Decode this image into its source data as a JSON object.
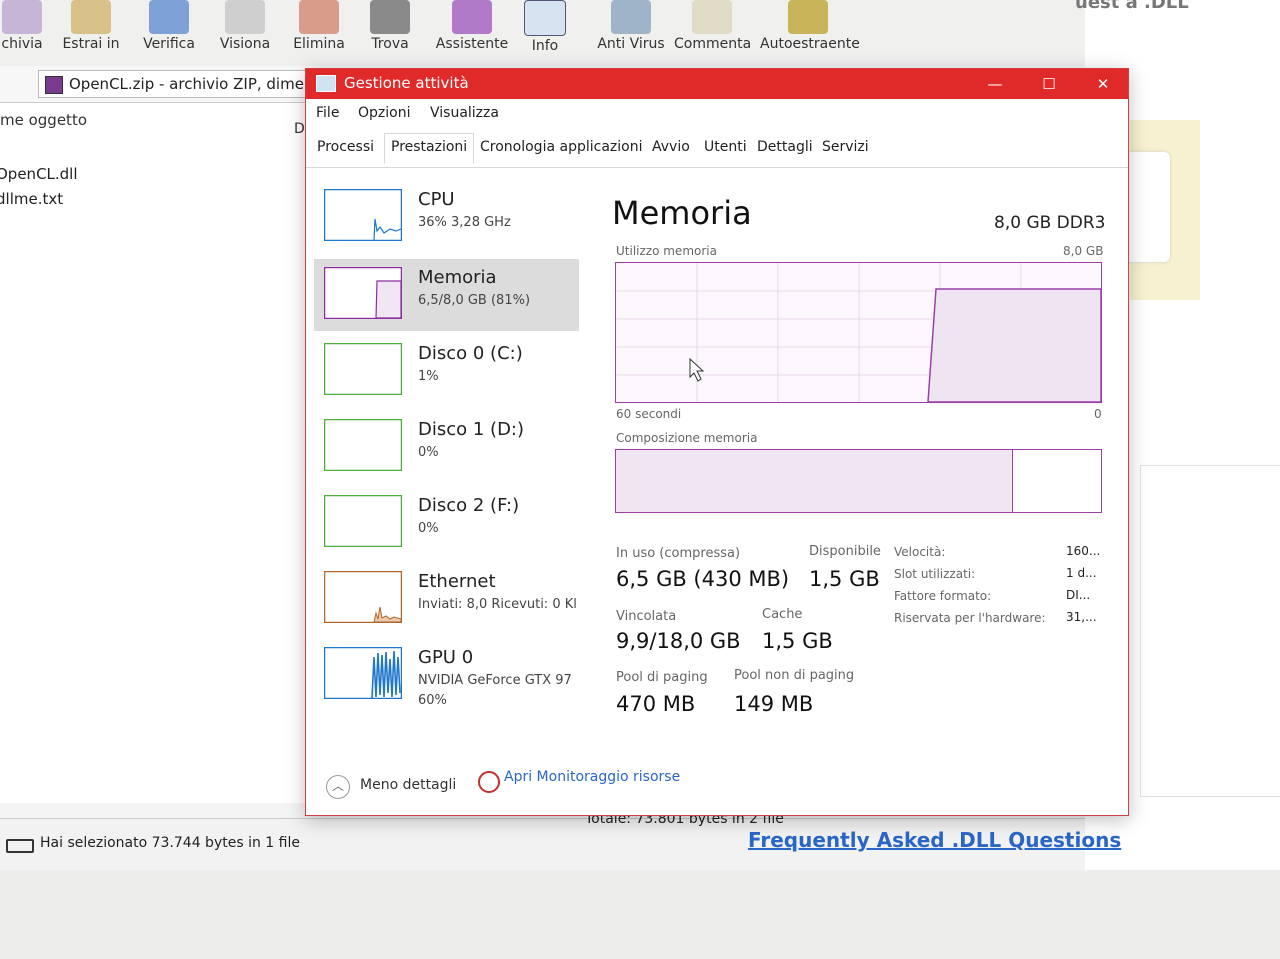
{
  "winrar": {
    "toolbar": [
      {
        "label": "chivia",
        "icon": "archive-icon"
      },
      {
        "label": "Estrai in",
        "icon": "extract-icon"
      },
      {
        "label": "Verifica",
        "icon": "test-icon"
      },
      {
        "label": "Visiona",
        "icon": "view-icon"
      },
      {
        "label": "Elimina",
        "icon": "delete-icon"
      },
      {
        "label": "Trova",
        "icon": "find-icon"
      },
      {
        "label": "Assistente",
        "icon": "wizard-icon"
      },
      {
        "label": "Info",
        "icon": "info-icon"
      },
      {
        "label": "Anti Virus",
        "icon": "antivirus-icon"
      },
      {
        "label": "Commenta",
        "icon": "comment-icon"
      },
      {
        "label": "Autoestraente",
        "icon": "sfx-icon"
      }
    ],
    "address": "OpenCL.zip - archivio ZIP, dime",
    "column_name": "me oggetto",
    "column_d": "D",
    "files": [
      "OpenCL.dll",
      "dllme.txt"
    ],
    "status_selected": "Hai selezionato 73.744 bytes in 1 file",
    "status_total": "Totale: 73.801 bytes in 2 file"
  },
  "web": {
    "heading_partial": "uest a .DLL",
    "link": "Frequently Asked .DLL Questions"
  },
  "taskmanager": {
    "title": "Gestione attività",
    "controls": {
      "minimize": "—",
      "maximize": "☐",
      "close": "✕"
    },
    "menu": [
      "File",
      "Opzioni",
      "Visualizza"
    ],
    "tabs": [
      "Processi",
      "Prestazioni",
      "Cronologia applicazioni",
      "Avvio",
      "Utenti",
      "Dettagli",
      "Servizi"
    ],
    "active_tab": "Prestazioni",
    "sidebar": [
      {
        "name": "CPU",
        "sub": "36% 3,28 GHz",
        "sub2": "",
        "color": "#1f77c9"
      },
      {
        "name": "Memoria",
        "sub": "6,5/8,0 GB (81%)",
        "sub2": "",
        "color": "#8b2fa0"
      },
      {
        "name": "Disco 0 (C:)",
        "sub": "1%",
        "sub2": "",
        "color": "#4caf3c"
      },
      {
        "name": "Disco 1 (D:)",
        "sub": "0%",
        "sub2": "",
        "color": "#4caf3c"
      },
      {
        "name": "Disco 2 (F:)",
        "sub": "0%",
        "sub2": "",
        "color": "#4caf3c"
      },
      {
        "name": "Ethernet",
        "sub": "Inviati: 8,0 Ricevuti: 0 Kl",
        "sub2": "",
        "color": "#b3662a"
      },
      {
        "name": "GPU 0",
        "sub": "NVIDIA GeForce GTX 97",
        "sub2": "60%",
        "color": "#1f77c9"
      }
    ],
    "memory": {
      "title": "Memoria",
      "spec": "8,0 GB DDR3",
      "usage_label": "Utilizzo memoria",
      "usage_max": "8,0 GB",
      "axis_left": "60 secondi",
      "axis_right": "0",
      "composition_label": "Composizione memoria",
      "in_use_label": "In uso (compressa)",
      "in_use_value": "6,5 GB (430 MB)",
      "available_label": "Disponibile",
      "available_value": "1,5 GB",
      "committed_label": "Vincolata",
      "committed_value": "9,9/18,0 GB",
      "cached_label": "Cache",
      "cached_value": "1,5 GB",
      "paged_label": "Pool di paging",
      "paged_value": "470 MB",
      "nonpaged_label": "Pool non di paging",
      "nonpaged_value": "149 MB",
      "details": [
        {
          "label": "Velocità:",
          "value": "160..."
        },
        {
          "label": "Slot utilizzati:",
          "value": "1 d..."
        },
        {
          "label": "Fattore formato:",
          "value": "DI..."
        },
        {
          "label": "Riservata per l'hardware:",
          "value": "31,..."
        }
      ]
    },
    "footer": {
      "fewer_details": "Meno dettagli",
      "resource_monitor": "Apri Monitoraggio risorse"
    }
  }
}
